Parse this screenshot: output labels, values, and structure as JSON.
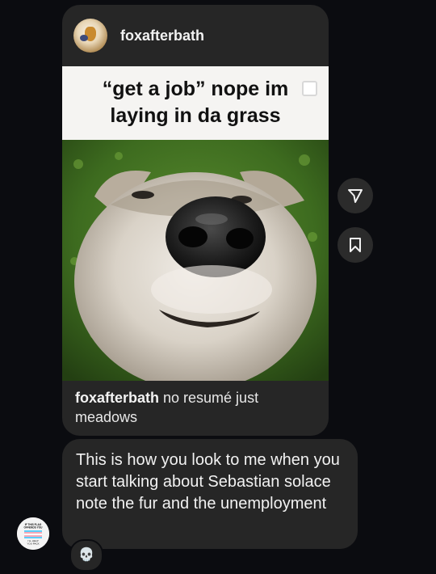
{
  "post": {
    "username": "foxafterbath",
    "meme_line1": "“get a job” nope im",
    "meme_line2": "laying in da grass",
    "caption_username": "foxafterbath",
    "caption_text": " no resumé just meadows"
  },
  "message": {
    "text": "This is how you look to me when you start talking about Sebastian solace note the fur and the unemployment"
  },
  "reaction": {
    "emoji": "💀"
  },
  "icons": {
    "share": "send-icon",
    "save": "bookmark-icon"
  },
  "sender_avatar": {
    "line1": "IF THIS FLAG",
    "line2": "OFFENDS YOU",
    "line3": "I'LL HELP",
    "line4": "YOU PACK"
  },
  "colors": {
    "background": "#0b0c10",
    "card": "#262626",
    "grass": "#3f6a22",
    "flag_blue": "#5bcefa",
    "flag_pink": "#f5a9b8"
  }
}
